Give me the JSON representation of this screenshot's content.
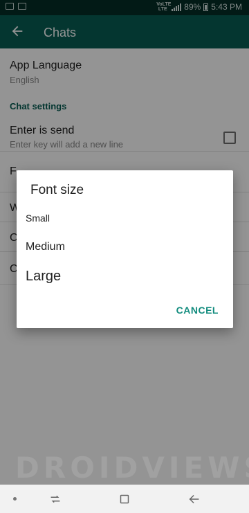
{
  "status_bar": {
    "network": "VoLTE LTE",
    "battery": "89%",
    "time": "5:43 PM"
  },
  "toolbar": {
    "title": "Chats"
  },
  "settings": {
    "app_language": {
      "title": "App Language",
      "value": "English"
    },
    "section_title": "Chat settings",
    "enter_is_send": {
      "title": "Enter is send",
      "subtitle": "Enter key will add a new line",
      "checked": false
    },
    "partial_items": [
      "F",
      "W",
      "C",
      "C"
    ]
  },
  "dialog": {
    "title": "Font size",
    "options": [
      {
        "label": "Small"
      },
      {
        "label": "Medium"
      },
      {
        "label": "Large"
      }
    ],
    "cancel_label": "CANCEL"
  },
  "watermark": "DROIDVIEWS",
  "colors": {
    "toolbar": "#075e54",
    "status_bar": "#052e27",
    "accent": "#128c7e"
  }
}
